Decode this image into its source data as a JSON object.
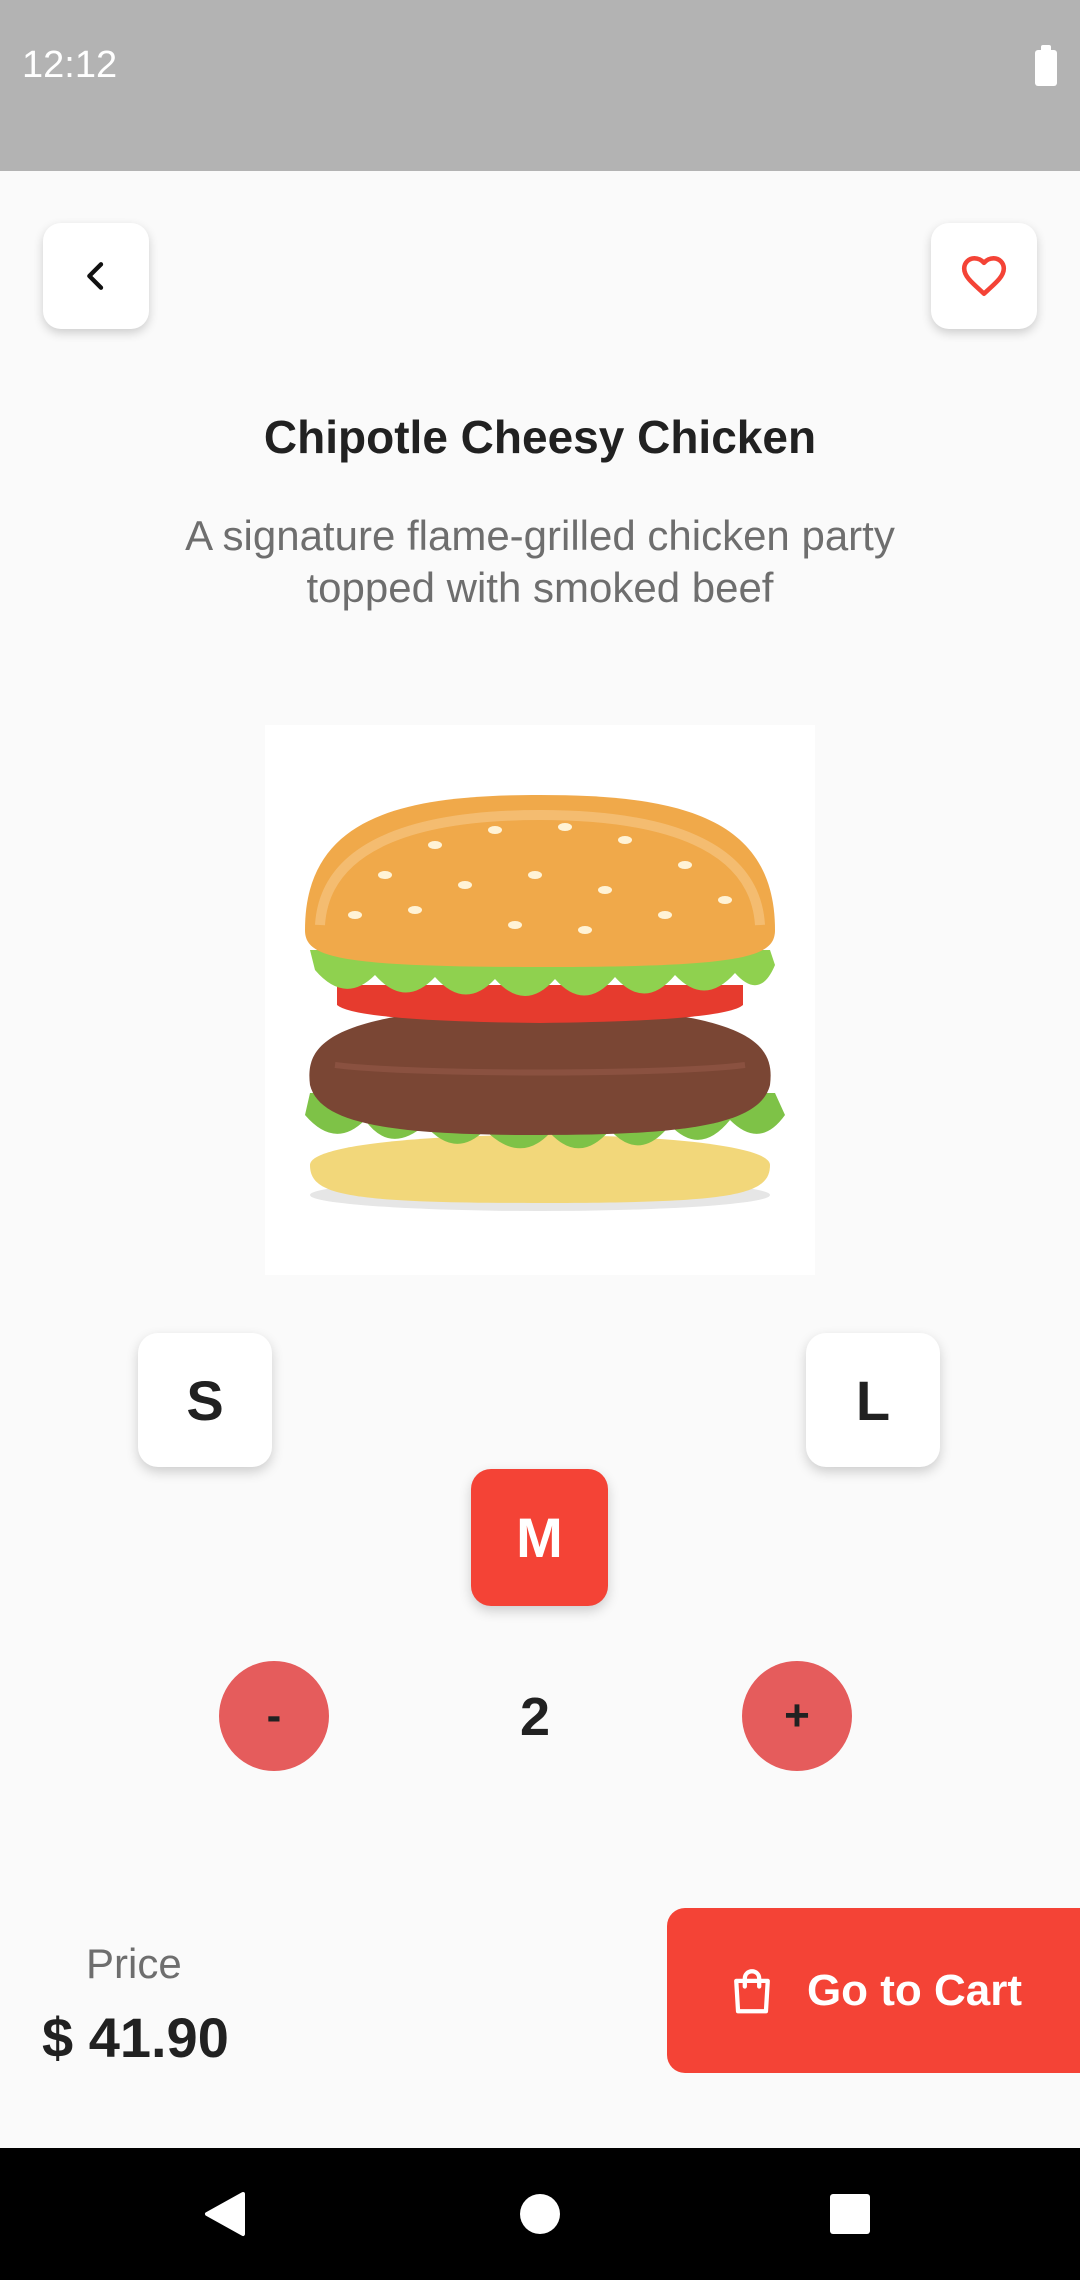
{
  "status_bar": {
    "time": "12:12"
  },
  "product": {
    "title": "Chipotle Cheesy Chicken",
    "description": "A signature flame-grilled chicken party topped with smoked beef"
  },
  "sizes": {
    "small": "S",
    "medium": "M",
    "large": "L",
    "selected": "M"
  },
  "quantity": {
    "minus_label": "-",
    "value": "2",
    "plus_label": "+"
  },
  "price": {
    "label": "Price",
    "value": "$ 41.90"
  },
  "cart_button": {
    "label": "Go to Cart"
  },
  "icons": {
    "back": "chevron-left-icon",
    "favorite": "heart-outline-icon",
    "cart": "shopping-bag-icon",
    "nav_back": "triangle-back-icon",
    "nav_home": "circle-home-icon",
    "nav_recents": "square-recents-icon"
  },
  "colors": {
    "accent": "#f44336",
    "quantity_button": "#e55c5c",
    "status_bar": "#b3b3b3",
    "background": "#fafafa"
  }
}
